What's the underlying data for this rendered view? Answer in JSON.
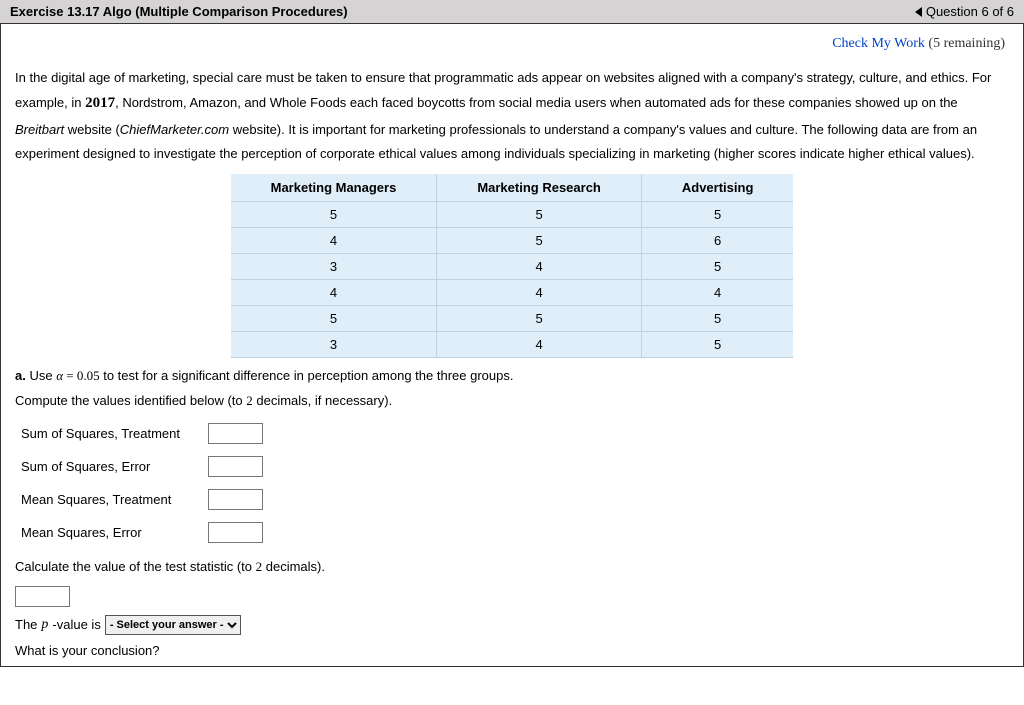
{
  "header": {
    "title": "Exercise 13.17 Algo (Multiple Comparison Procedures)",
    "nav_text": "Question 6 of 6"
  },
  "check": {
    "link_text": "Check My Work",
    "remaining": "(5 remaining)"
  },
  "prose": {
    "p1a": "In the digital age of marketing, special care must be taken to ensure that programmatic ads appear on websites aligned with a company's strategy, culture, and ethics. For example, in ",
    "year": "2017",
    "p1b": ", Nordstrom, Amazon, and Whole Foods each faced boycotts from social media users when automated ads for these companies showed up on the ",
    "breitbart": "Breitbart",
    "p1c": " website (",
    "chief": "ChiefMarketer.com",
    "p1d": " website). It is important for marketing professionals to understand a company's values and culture. The following data are from an experiment designed to investigate the perception of corporate ethical values among individuals specializing in marketing (higher scores indicate higher ethical values)."
  },
  "table": {
    "headers": [
      "Marketing Managers",
      "Marketing Research",
      "Advertising"
    ],
    "rows": [
      [
        "5",
        "5",
        "5"
      ],
      [
        "4",
        "5",
        "6"
      ],
      [
        "3",
        "4",
        "5"
      ],
      [
        "4",
        "4",
        "4"
      ],
      [
        "5",
        "5",
        "5"
      ],
      [
        "3",
        "4",
        "5"
      ]
    ]
  },
  "partA": {
    "label": "a.",
    "text1": " Use ",
    "alpha": "α",
    "eq": " = ",
    "alphaval": "0.05",
    "text2": " to test for a significant difference in perception among the three groups.",
    "compute": "Compute the values identified below (to ",
    "two": "2",
    "compute2": " decimals, if necessary)."
  },
  "form": {
    "sst": "Sum of Squares, Treatment",
    "sse": "Sum of Squares, Error",
    "mst": "Mean Squares, Treatment",
    "mse": "Mean Squares, Error"
  },
  "calc": {
    "text1": "Calculate the value of the test statistic (to ",
    "two": "2",
    "text2": " decimals)."
  },
  "pvalue": {
    "pre": "The ",
    "p": "p",
    "post": "-value is",
    "placeholder": "- Select your answer -"
  },
  "conclusion": {
    "text": "What is your conclusion?"
  }
}
